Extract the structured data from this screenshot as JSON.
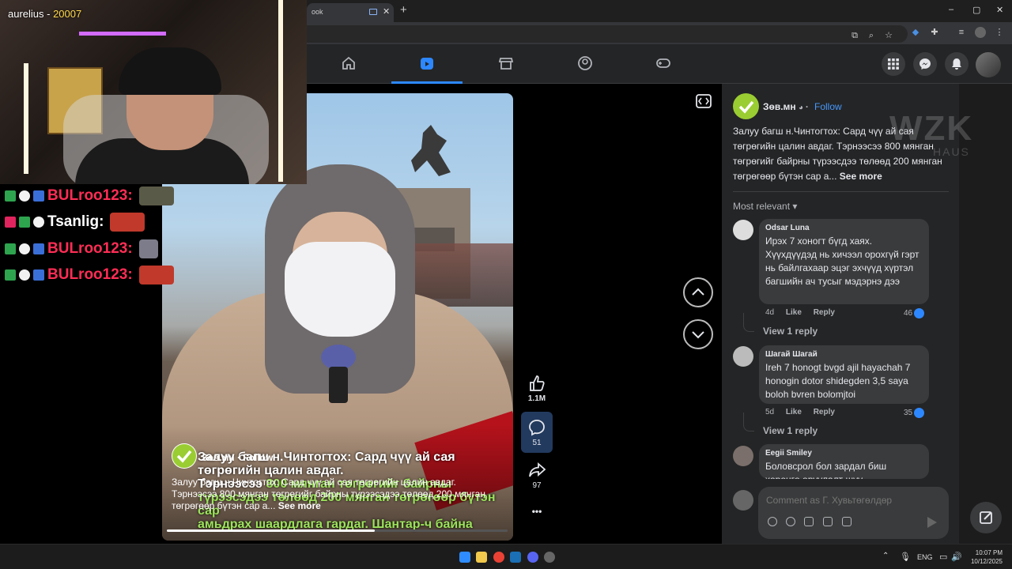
{
  "browser": {
    "tab_title": "ook",
    "new_tab": "+",
    "window_controls": [
      "–",
      "▢",
      "✕"
    ]
  },
  "stream": {
    "title_name": "aurelius - ",
    "title_number": "20007"
  },
  "chat": [
    {
      "user": "BULroo123:",
      "badges": [
        "1st",
        "sub",
        "flag"
      ]
    },
    {
      "user": "Tsanlig:",
      "badges": [
        "heart",
        "1st",
        "sub"
      ]
    },
    {
      "user": "BULroo123:",
      "badges": [
        "1st",
        "sub",
        "flag"
      ]
    },
    {
      "user": "BULroo123:",
      "badges": [
        "1st",
        "sub",
        "flag"
      ]
    }
  ],
  "nav": {
    "items": [
      "home-icon",
      "video-icon",
      "marketplace-icon",
      "groups-icon",
      "gaming-icon"
    ],
    "active_index": 1,
    "accent": "#2d88ff"
  },
  "video": {
    "overlay_line1": "Залуу багш н.Чинтогтох: Сард чүү ай сая төгрөгийн цалин авдаг.",
    "overlay_line2a": "Тэрнээсээ ",
    "overlay_line2b": "800 мянган төгрөгийг байрны",
    "overlay_line3": "түрээсэдээ төлөөд 200 мянган төгрөгөөр бүтэн сар",
    "overlay_line4": "амьдрах шаардлага гардаг. Шантар-ч байна",
    "page_name": "Зөв.мн · Follow",
    "caption": "Залуу багш н.Чинтогтох: Сард чүү ай сая төгрөгийн цалин авдаг. Тэрнээсээ 800 мянган төгрөгийг байрны түрээсэдээ төлөөд 200 мянган төгрөгөөр бүтэн сар а...",
    "see_more": "See more",
    "progress_fraction": 0.61
  },
  "actions": {
    "likes": "1.1M",
    "comments": "51",
    "shares": "97",
    "more": "•••"
  },
  "post": {
    "page_name": "Зөв.мн",
    "privacy_sep": "·",
    "follow": "Follow",
    "text": "Залуу багш н.Чинтогтох: Сард чүү ай сая төгрөгийн цалин авдаг. Тэрнээсээ 800 мянган төгрөгийг байрны түрээсдээ төлөөд 200 мянган төгрөгөөр бүтэн сар а...",
    "see_more": "See more",
    "sort_label": "Most relevant"
  },
  "comments": [
    {
      "name": "Odsar Luna",
      "text": "Ирэх 7 хоногт бүгд хаях. Хүүхдүүдэд нь хичээл орохгүй гэрт нь байлгахаар эцэг эхчүүд хүртэл багшийн ач тусыг мэдэрнэ дээ",
      "age": "4d",
      "like": "Like",
      "reply": "Reply",
      "likes": "46",
      "view_replies": "View 1 reply"
    },
    {
      "name": "Шагай Шагай",
      "text": "Ireh 7 honogt bvgd ajil hayachah 7 honogin dotor shidegden 3,5 saya boloh bvren bolomjtoi",
      "age": "5d",
      "like": "Like",
      "reply": "Reply",
      "likes": "35",
      "view_replies": "View 1 reply"
    },
    {
      "name": "Eegii Smiley",
      "text": "Боловсрол бол зардал биш хөрөнгө оруулалт шүү"
    }
  ],
  "composer": {
    "placeholder": "Comment as Г. Хувьтөгөлдөр"
  },
  "watermark": {
    "line1": "WZK",
    "line2": "HAUS"
  },
  "taskbar": {
    "lang": "ENG",
    "time": "10:07 PM",
    "date": "10/12/2025"
  }
}
